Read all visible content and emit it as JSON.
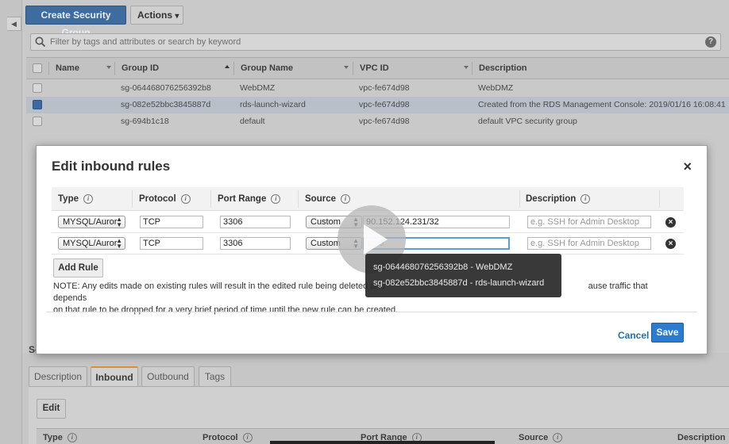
{
  "toolbar": {
    "create_label": "Create Security Group",
    "actions_label": "Actions",
    "actions_caret": "▾"
  },
  "search": {
    "placeholder": "Filter by tags and attributes or search by keyword",
    "help": "?"
  },
  "grid": {
    "columns": [
      "Name",
      "Group ID",
      "Group Name",
      "VPC ID",
      "Description"
    ],
    "rows": [
      {
        "name": "",
        "group_id": "sg-064468076256392b8",
        "group_name": "WebDMZ",
        "vpc_id": "vpc-fe674d98",
        "description": "WebDMZ",
        "selected": false
      },
      {
        "name": "",
        "group_id": "sg-082e52bbc3845887d",
        "group_name": "rds-launch-wizard",
        "vpc_id": "vpc-fe674d98",
        "description": "Created from the RDS Management Console: 2019/01/16 16:08:41",
        "selected": true
      },
      {
        "name": "",
        "group_id": "sg-694b1c18",
        "group_name": "default",
        "vpc_id": "vpc-fe674d98",
        "description": "default VPC security group",
        "selected": false
      }
    ]
  },
  "modal": {
    "title": "Edit inbound rules",
    "close": "×",
    "columns": [
      "Type",
      "Protocol",
      "Port Range",
      "Source",
      "Description"
    ],
    "rules": [
      {
        "type": "MYSQL/Auror",
        "protocol": "TCP",
        "port_range": "3306",
        "source_type": "Custom",
        "source_value": "90.152.124.231/32",
        "source_placeholder": "",
        "description_placeholder": "e.g. SSH for Admin Desktop"
      },
      {
        "type": "MYSQL/Auror",
        "protocol": "TCP",
        "port_range": "3306",
        "source_type": "Custom",
        "source_value": "",
        "source_placeholder": "sg-0",
        "description_placeholder": "e.g. SSH for Admin Desktop"
      }
    ],
    "add_rule_label": "Add Rule",
    "note_line1": "NOTE: Any edits made on existing rules will result in the edited rule being deleted and",
    "note_line1_end": "ause traffic that depends",
    "note_line2": "on that rule to be dropped for a very brief period of time until the new rule can be created.",
    "cancel_label": "Cancel",
    "save_label": "Save"
  },
  "source_suggestions": [
    "sg-064468076256392b8 - WebDMZ",
    "sg-082e52bbc3845887d - rds-launch-wizard"
  ],
  "bottom": {
    "section_label": "Se",
    "tabs": [
      "Description",
      "Inbound",
      "Outbound",
      "Tags"
    ],
    "active_tab": "Inbound",
    "edit_label": "Edit",
    "columns": [
      "Type",
      "Protocol",
      "Port Range",
      "Source",
      "Description"
    ]
  },
  "colors": {
    "primary": "#2b7bd1",
    "link": "#1f6fb5",
    "active_tab_accent": "#d88f36"
  }
}
